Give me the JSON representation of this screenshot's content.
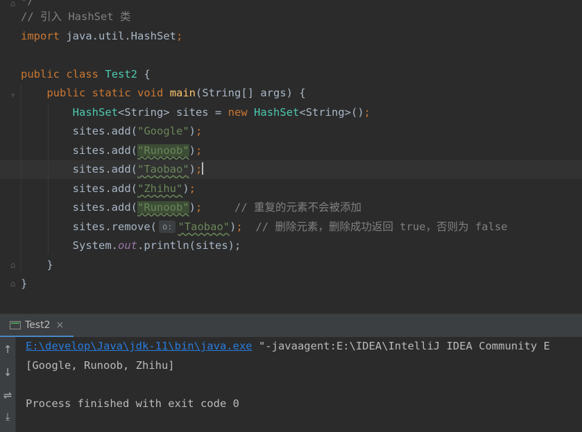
{
  "editor": {
    "comment_top": "*/",
    "comment_import": "// 引入 HashSet 类",
    "kw_import": "import",
    "import_path": "java.util.HashSet",
    "semicolon": ";",
    "kw_public": "public",
    "kw_class": "class",
    "class_name": "Test2",
    "kw_static": "static",
    "kw_void": "void",
    "method_main": "main",
    "main_params": "(String[] args) {",
    "hashset_type": "HashSet",
    "generic_string": "<String>",
    "var_sites": "sites",
    "kw_new": "new",
    "sites_prefix": "sites.",
    "m_add": "add",
    "m_remove": "remove",
    "str_google": "\"Google\"",
    "str_runoob": "\"Runoob\"",
    "str_taobao": "\"Taobao\"",
    "str_zhihu": "\"Zhihu\"",
    "comment_dup": "// 重复的元素不会被添加",
    "param_hint": "o:",
    "comment_remove": "// 删除元素，删除成功返回 true，否则为 false",
    "system": "System",
    "field_out": "out",
    "m_println": "println",
    "println_args": "(sites);",
    "close_brace": "}"
  },
  "run_panel": {
    "tab_label": "Test2",
    "tab_close": "×",
    "java_exe_path": "E:\\develop\\Java\\jdk-11\\bin\\java.exe",
    "java_args": " \"-javaagent:E:\\IDEA\\IntelliJ IDEA Community E",
    "output_line": "[Google, Runoob, Zhihu]",
    "finish_line": "Process finished with exit code 0"
  },
  "icons": {
    "up": "arrow-up-icon",
    "down": "arrow-down-icon",
    "wrap": "soft-wrap-icon",
    "scroll": "scroll-to-end-icon"
  }
}
